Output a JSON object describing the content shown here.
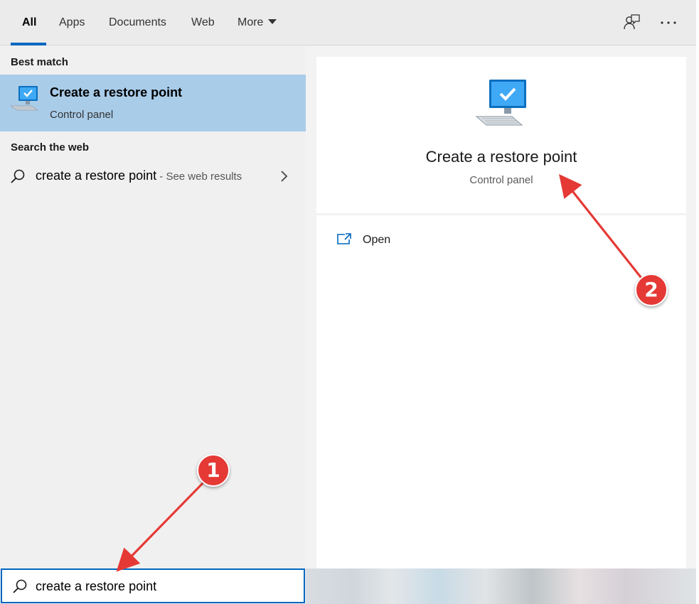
{
  "tabs": [
    {
      "label": "All",
      "active": true
    },
    {
      "label": "Apps"
    },
    {
      "label": "Documents"
    },
    {
      "label": "Web"
    },
    {
      "label": "More"
    }
  ],
  "top_icons": [
    "feedback-icon",
    "more-options-icon"
  ],
  "left": {
    "best_match_heading": "Best match",
    "best_match": {
      "title": "Create a restore point",
      "subtitle": "Control panel",
      "icon": "computer-check-icon"
    },
    "web_heading": "Search the web",
    "web_result": {
      "query": "create a restore point",
      "hint": " - See web results"
    }
  },
  "preview": {
    "title": "Create a restore point",
    "subtitle": "Control panel",
    "icon": "computer-check-icon",
    "actions": [
      {
        "label": "Open",
        "icon": "open-window-icon"
      }
    ]
  },
  "search": {
    "value": "create a restore point"
  },
  "annotations": [
    {
      "label": "1"
    },
    {
      "label": "2"
    }
  ],
  "colors": {
    "accent": "#0067c0",
    "selected": "#a9cce9",
    "annotation": "#e53935"
  }
}
